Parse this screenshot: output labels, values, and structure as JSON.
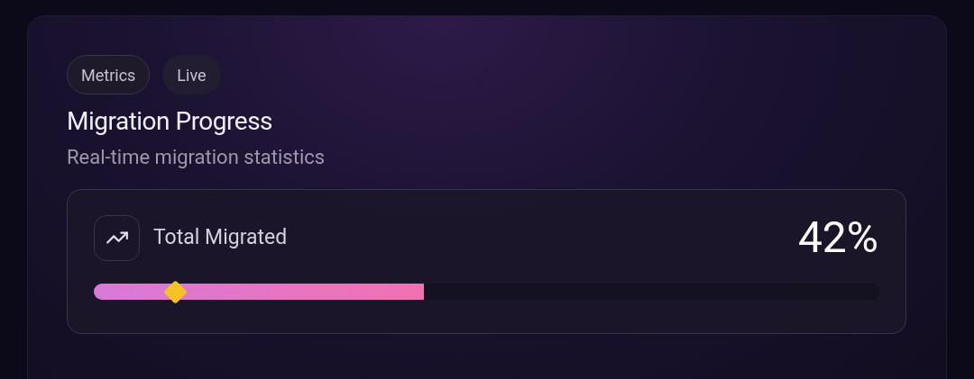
{
  "card": {
    "tags": [
      {
        "label": "Metrics",
        "outlined": true
      },
      {
        "label": "Live",
        "outlined": false
      }
    ],
    "title": "Migration Progress",
    "subtitle": "Real-time migration statistics",
    "stat": {
      "label": "Total Migrated",
      "value": "42%",
      "level": 0.42
    }
  }
}
